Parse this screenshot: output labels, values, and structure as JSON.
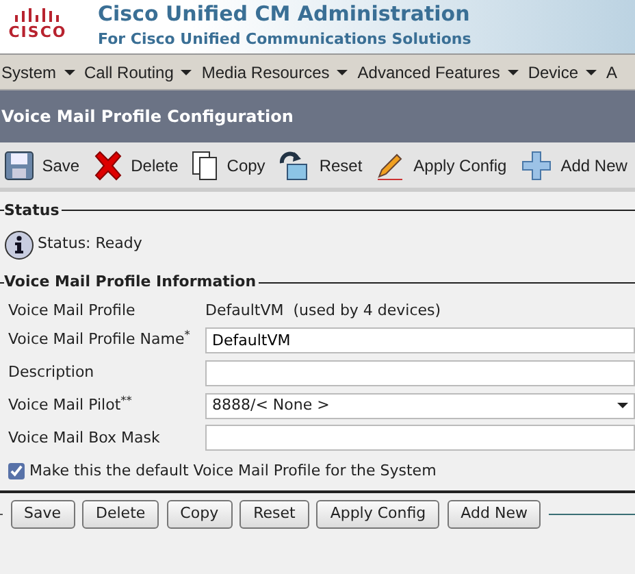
{
  "header": {
    "logo": "CISCO",
    "title": "Cisco Unified CM Administration",
    "subtitle": "For Cisco Unified Communications Solutions"
  },
  "menu": [
    {
      "label": "System"
    },
    {
      "label": "Call Routing"
    },
    {
      "label": "Media Resources"
    },
    {
      "label": "Advanced Features"
    },
    {
      "label": "Device"
    },
    {
      "label": "A"
    }
  ],
  "page_title": "Voice Mail Profile Configuration",
  "toolbar": [
    {
      "label": "Save",
      "kind": "save"
    },
    {
      "label": "Delete",
      "kind": "delete"
    },
    {
      "label": "Copy",
      "kind": "copy"
    },
    {
      "label": "Reset",
      "kind": "reset"
    },
    {
      "label": "Apply Config",
      "kind": "apply"
    },
    {
      "label": "Add New",
      "kind": "add"
    }
  ],
  "status": {
    "legend": "Status",
    "text": "Status: Ready"
  },
  "info": {
    "legend": "Voice Mail Profile Information",
    "profile_label": "Voice Mail Profile",
    "profile_value": "DefaultVM  (used by 4 devices)",
    "fields": [
      {
        "label": "Voice Mail Profile Name",
        "marker": "*",
        "kind": "text",
        "value": "DefaultVM"
      },
      {
        "label": "Description",
        "kind": "text"
      },
      {
        "label": "Voice Mail Pilot",
        "marker": "**",
        "kind": "select",
        "value": "8888/< None >"
      },
      {
        "label": "Voice Mail Box Mask",
        "kind": "text"
      }
    ],
    "checkbox": {
      "label": "Make this the default Voice Mail Profile for the System",
      "checked": true
    }
  },
  "buttons": [
    "Save",
    "Delete",
    "Copy",
    "Reset",
    "Apply Config",
    "Add New"
  ]
}
